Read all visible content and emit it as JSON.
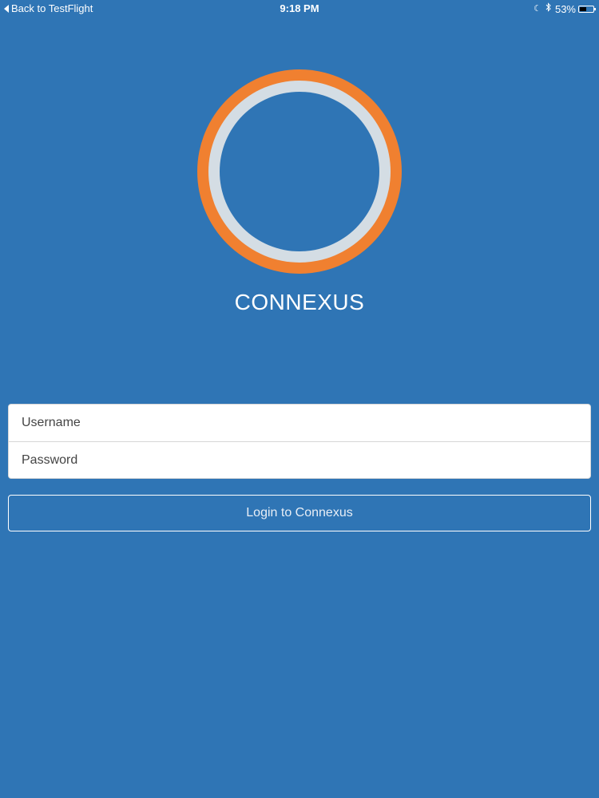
{
  "status_bar": {
    "back_label": "Back to TestFlight",
    "time": "9:18 PM",
    "battery_percent_label": "53%",
    "battery_level": 0.53,
    "icons": [
      "moon-icon",
      "bluetooth-icon",
      "battery-icon"
    ]
  },
  "logo": {
    "ring_outer_color": "#f08030",
    "ring_inner_color": "#d4dde4",
    "center_color": "#2f75b5"
  },
  "app": {
    "name": "CONNEXUS"
  },
  "form": {
    "username_placeholder": "Username",
    "username_value": "",
    "password_placeholder": "Password",
    "password_value": ""
  },
  "actions": {
    "login_label": "Login to Connexus"
  },
  "colors": {
    "background": "#2f75b5",
    "accent": "#f08030"
  }
}
